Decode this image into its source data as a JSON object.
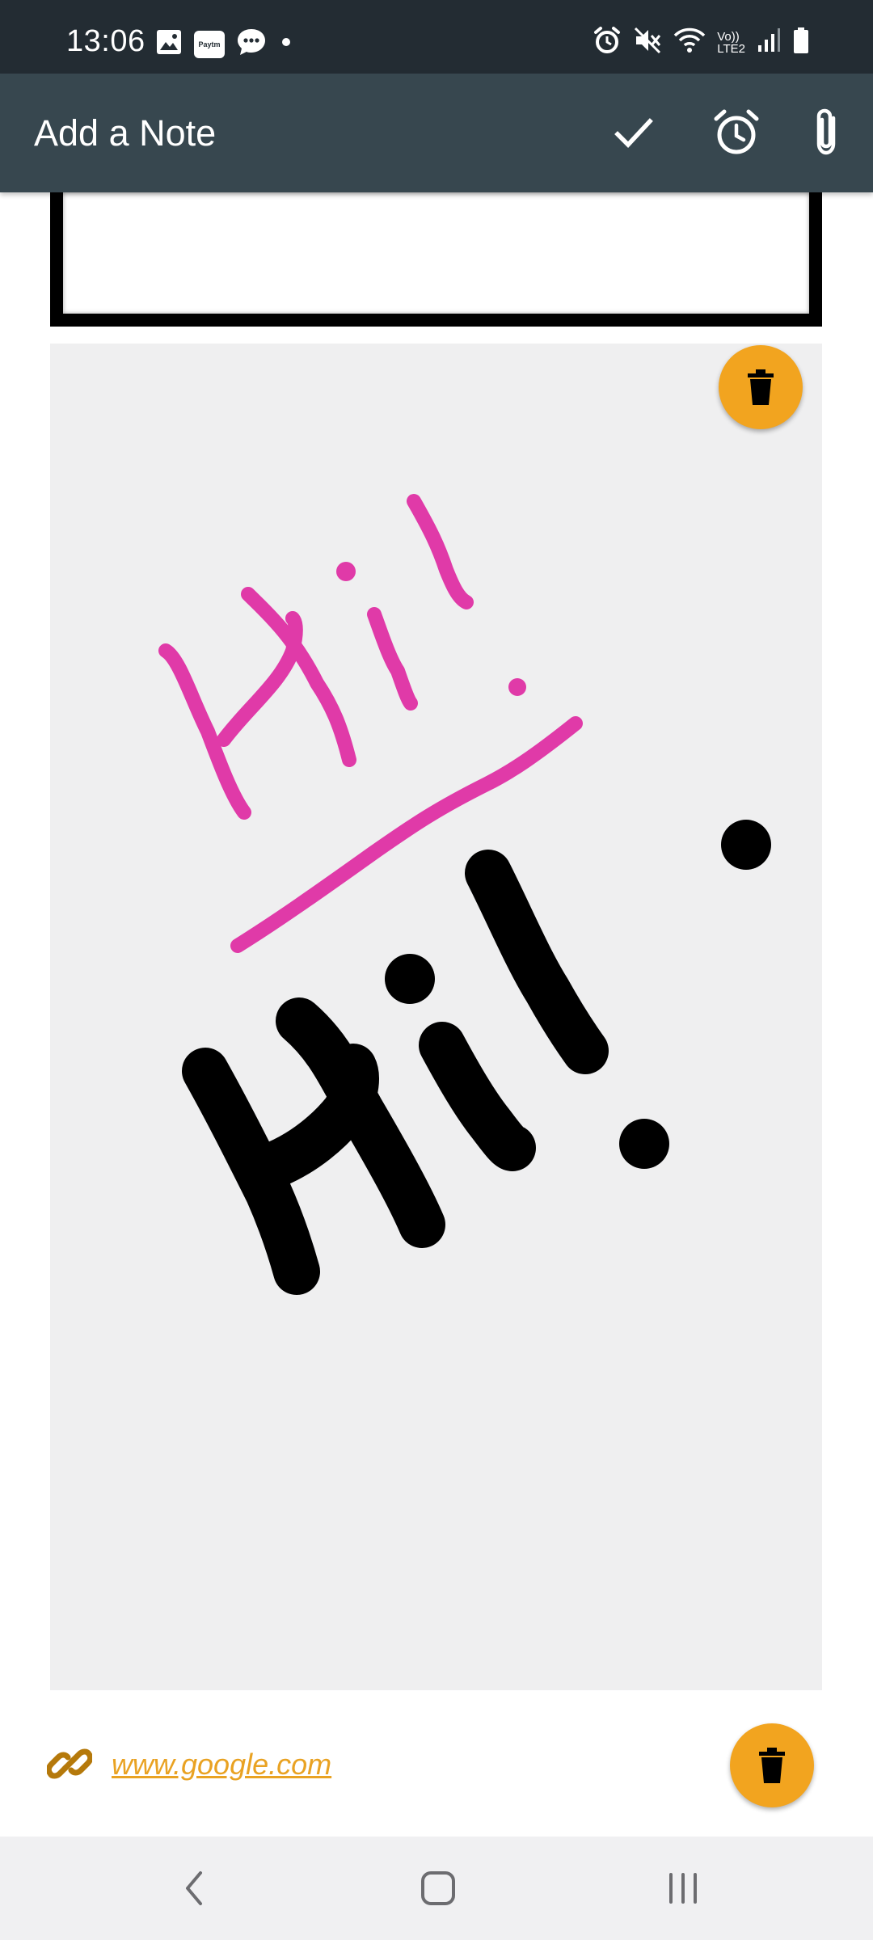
{
  "status_bar": {
    "time": "13:06",
    "left_icons": [
      "gallery-icon",
      "paytm-icon",
      "messages-icon",
      "dot-icon"
    ],
    "paytm_label": "Paytm",
    "right_icons": [
      "alarm-icon",
      "mute-icon",
      "wifi-icon",
      "volte-icon",
      "signal-icon",
      "battery-icon"
    ],
    "volte_label_top": "Vo))",
    "volte_label_bottom": "LTE2"
  },
  "app_bar": {
    "title": "Add a Note",
    "actions": [
      "check-icon",
      "alarm-clock-icon",
      "paperclip-icon"
    ]
  },
  "sketch": {
    "background": "#efeff0",
    "pink_color": "#e03aa8",
    "black_color": "#000000"
  },
  "attachment": {
    "link_text": "www.google.com",
    "link_color": "#e9a222"
  },
  "colors": {
    "status_bar": "#232c33",
    "app_bar": "#37474f",
    "fab": "#f2a41f"
  },
  "nav_bar": {
    "buttons": [
      "back-icon",
      "home-icon",
      "recents-icon"
    ]
  }
}
